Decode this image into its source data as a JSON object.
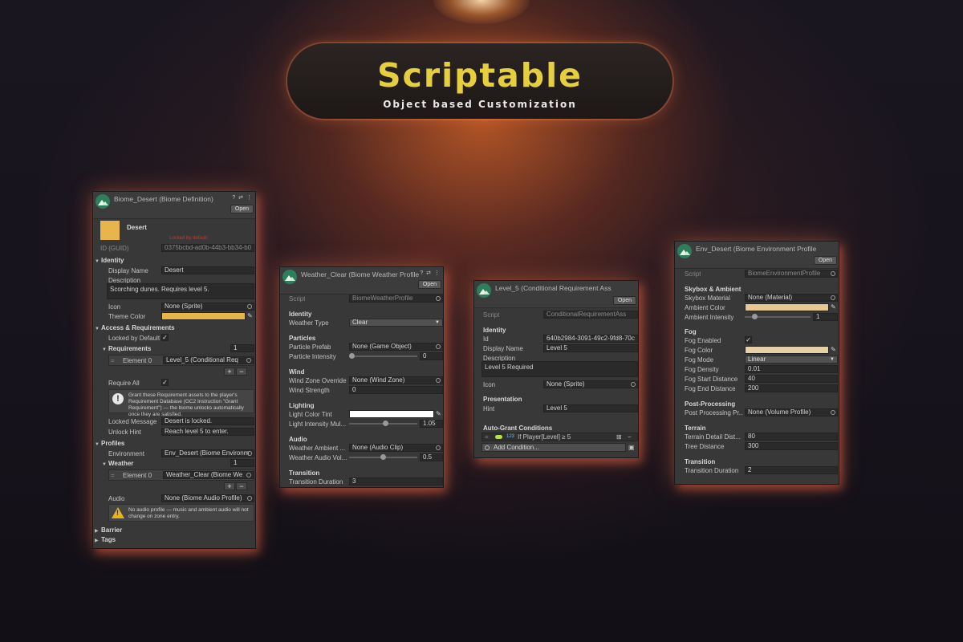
{
  "header": {
    "title": "Scriptable",
    "subtitle": "Object based Customization"
  },
  "icons": {
    "panel_logo": "mountain-logo-icon",
    "help": "question-icon",
    "settings": "sliders-icon",
    "menu": "kebab-menu-icon",
    "picker": "object-picker-icon",
    "eyedropper": "eyedropper-icon",
    "info": "info-icon",
    "warning": "warning-icon"
  },
  "colors": {
    "accent_title": "#e6cf3e",
    "theme_color": "#e8b54c",
    "fog_color": "#e6d1a6",
    "ambient_color": "#e6c890",
    "light_tint": "#ffffff",
    "red_note": "#c83a2a"
  },
  "common": {
    "open_label": "Open",
    "script_label": "Script",
    "panel_icons": "? ⇄ ⋮"
  },
  "biome": {
    "title": "Biome_Desert (Biome Definition)",
    "name": "Desert",
    "locked_note": "Locked by default",
    "id_label": "ID (GUID)",
    "id_value": "0375bcbd-ad0b-44b3-bb34-b0",
    "identity_header": "Identity",
    "display_name_label": "Display Name",
    "display_name_value": "Desert",
    "description_label": "Description",
    "description_value": "Scorching dunes. Requires level 5.",
    "icon_label": "Icon",
    "icon_value": "None (Sprite)",
    "theme_color_label": "Theme Color",
    "access_header": "Access & Requirements",
    "locked_label": "Locked by Default",
    "locked_checked": true,
    "requirements_label": "Requirements",
    "requirements_count": "1",
    "req_element_label": "Element 0",
    "req_element_value": "Level_5 (Conditional Req",
    "require_all_label": "Require All",
    "require_all_checked": true,
    "help_text": "Grant these Requirement assets to the player's Requirement Database (GC2 Instruction \"Grant Requirement\") — the biome unlocks automatically once they are satisfied.",
    "locked_msg_label": "Locked Message",
    "locked_msg_value": "Desert is locked.",
    "unlock_hint_label": "Unlock Hint",
    "unlock_hint_value": "Reach level 5 to enter.",
    "profiles_header": "Profiles",
    "environment_label": "Environment",
    "environment_value": "Env_Desert (Biome Environm",
    "weather_label": "Weather",
    "weather_count": "1",
    "weather_element_label": "Element 0",
    "weather_element_value": "Weather_Clear (Biome We",
    "audio_label": "Audio",
    "audio_value": "None (Biome Audio Profile)",
    "audio_warning": "No audio profile — music and ambient audio will not change on zone entry.",
    "barrier_label": "Barrier",
    "tags_label": "Tags",
    "plus": "+",
    "minus": "−"
  },
  "weather": {
    "title": "Weather_Clear (Biome Weather Profile",
    "script_value": "BiomeWeatherProfile",
    "identity_header": "Identity",
    "weather_type_label": "Weather Type",
    "weather_type_value": "Clear",
    "particles_header": "Particles",
    "particle_prefab_label": "Particle Prefab",
    "particle_prefab_value": "None (Game Object)",
    "particle_intensity_label": "Particle Intensity",
    "particle_intensity_value": "0",
    "particle_intensity_level": 0,
    "wind_header": "Wind",
    "wind_zone_label": "Wind Zone Override",
    "wind_zone_value": "None (Wind Zone)",
    "wind_strength_label": "Wind Strength",
    "wind_strength_value": "0",
    "lighting_header": "Lighting",
    "light_tint_label": "Light Color Tint",
    "light_intensity_label": "Light Intensity Mul...",
    "light_intensity_value": "1.05",
    "light_intensity_level": 0.52,
    "audio_header": "Audio",
    "ambient_label": "Weather Ambient ...",
    "ambient_value": "None (Audio Clip)",
    "volume_label": "Weather Audio Vol...",
    "volume_value": "0.5",
    "volume_level": 0.5,
    "transition_header": "Transition",
    "transition_label": "Transition Duration",
    "transition_value": "3"
  },
  "level": {
    "title": "Level_5 (Conditional Requirement Ass",
    "script_value": "ConditionalRequirementAss",
    "identity_header": "Identity",
    "id_label": "Id",
    "id_value": "640b2984-3091-49c2-9fd8-70c",
    "display_name_label": "Display Name",
    "display_name_value": "Level 5",
    "description_label": "Description",
    "description_value": "Level 5 Required",
    "icon_label": "Icon",
    "icon_value": "None (Sprite)",
    "presentation_header": "Presentation",
    "hint_label": "Hint",
    "hint_value": "Level 5",
    "auto_grant_header": "Auto-Grant Conditions",
    "condition_number": "123",
    "condition_text": "If Player[Level] ≥ 5",
    "add_condition_label": "Add Condition..."
  },
  "env": {
    "title": "Env_Desert (Biome Environment Profile",
    "script_value": "BiomeEnvironmentProfile",
    "skybox_header": "Skybox & Ambient",
    "skybox_label": "Skybox Material",
    "skybox_value": "None (Material)",
    "ambient_color_label": "Ambient Color",
    "ambient_intensity_label": "Ambient Intensity",
    "ambient_intensity_value": "1",
    "ambient_intensity_level": 0.12,
    "fog_header": "Fog",
    "fog_enabled_label": "Fog Enabled",
    "fog_enabled_checked": true,
    "fog_color_label": "Fog Color",
    "fog_mode_label": "Fog Mode",
    "fog_mode_value": "Linear",
    "fog_density_label": "Fog Density",
    "fog_density_value": "0.01",
    "fog_start_label": "Fog Start Distance",
    "fog_start_value": "40",
    "fog_end_label": "Fog End Distance",
    "fog_end_value": "200",
    "post_header": "Post-Processing",
    "post_label": "Post Processing Pr...",
    "post_value": "None (Volume Profile)",
    "terrain_header": "Terrain",
    "terrain_detail_label": "Terrain Detail Dist...",
    "terrain_detail_value": "80",
    "tree_distance_label": "Tree Distance",
    "tree_distance_value": "300",
    "transition_header": "Transition",
    "transition_label": "Transition Duration",
    "transition_value": "2"
  }
}
